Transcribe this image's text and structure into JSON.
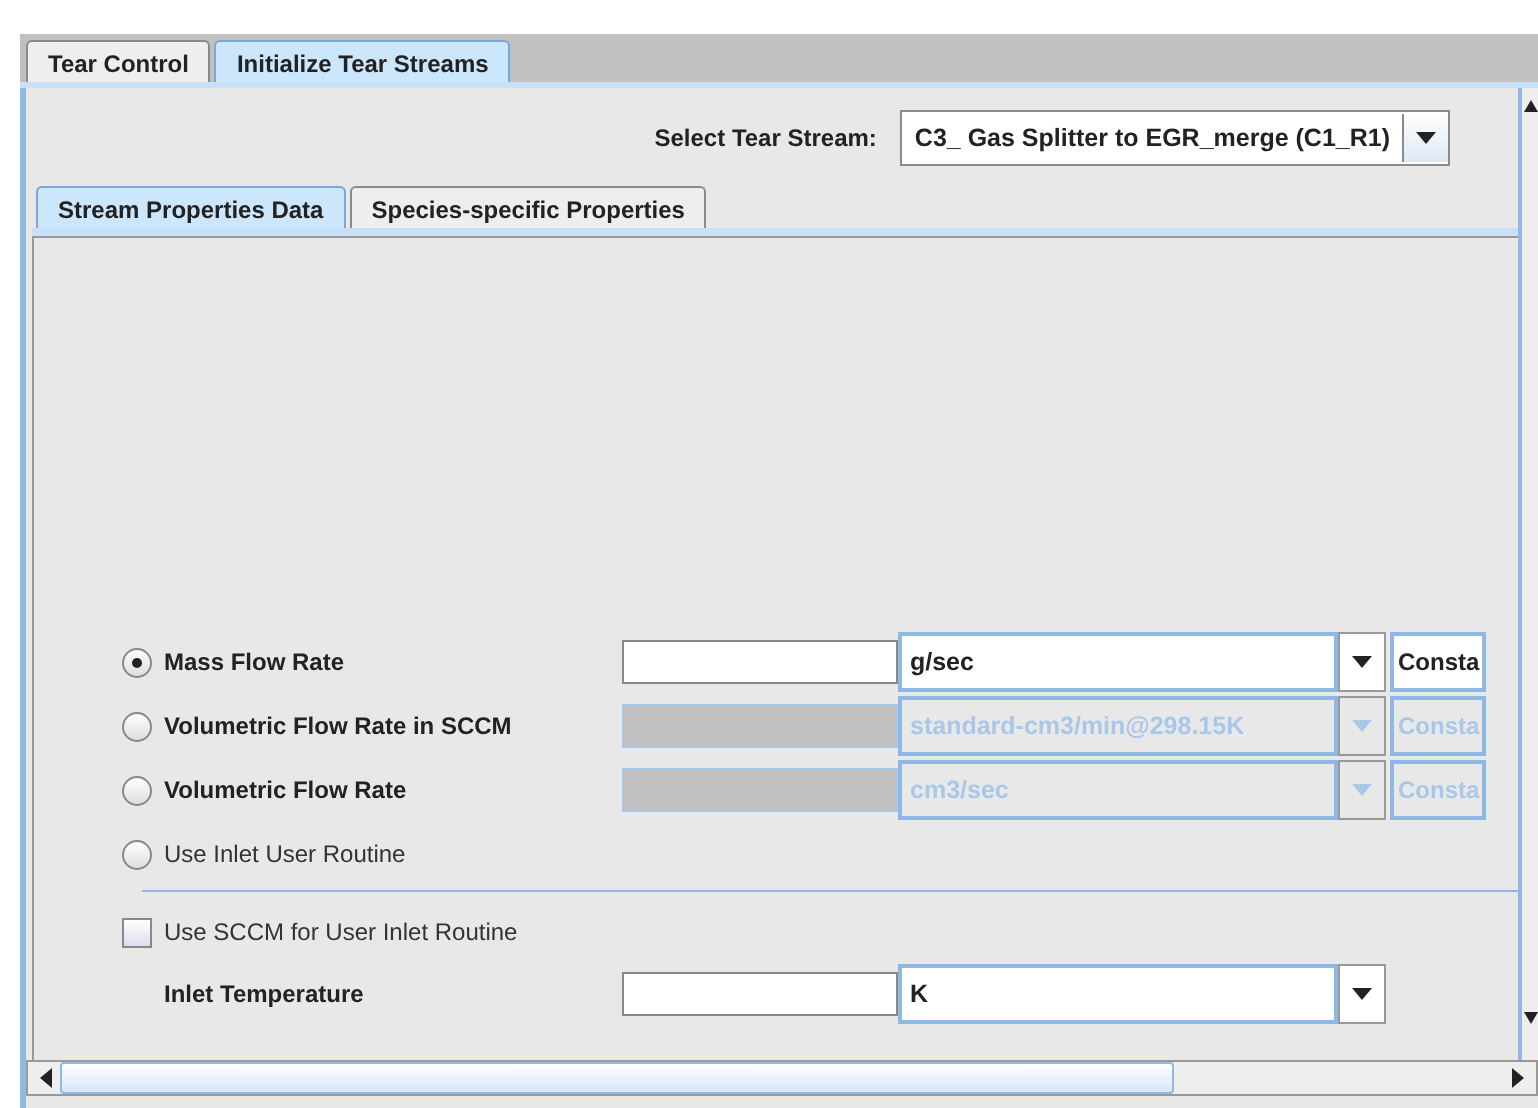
{
  "outer_tabs": [
    {
      "label": "Tear Control",
      "selected": false
    },
    {
      "label": "Initialize Tear Streams",
      "selected": true
    }
  ],
  "tear_stream": {
    "label": "Select Tear Stream:",
    "value": "C3_ Gas Splitter to EGR_merge (C1_R1)"
  },
  "inner_tabs": [
    {
      "label": "Stream Properties Data",
      "selected": true
    },
    {
      "label": "Species-specific Properties",
      "selected": false
    }
  ],
  "flow_options": [
    {
      "kind": "flow",
      "label": "Mass Flow Rate",
      "selected": true,
      "disabled": false,
      "unit": "g/sec",
      "mode": "Consta"
    },
    {
      "kind": "flow",
      "label": "Volumetric Flow Rate in SCCM",
      "selected": false,
      "disabled": true,
      "unit": "standard-cm3/min@298.15K",
      "mode": "Consta"
    },
    {
      "kind": "flow",
      "label": "Volumetric Flow Rate",
      "selected": false,
      "disabled": true,
      "unit": "cm3/sec",
      "mode": "Consta"
    },
    {
      "kind": "routine",
      "label": "Use Inlet User Routine",
      "selected": false
    }
  ],
  "sccm_option": {
    "label": "Use SCCM for User Inlet Routine",
    "checked": false
  },
  "inlet_temperature": {
    "label": "Inlet Temperature",
    "unit": "K"
  }
}
